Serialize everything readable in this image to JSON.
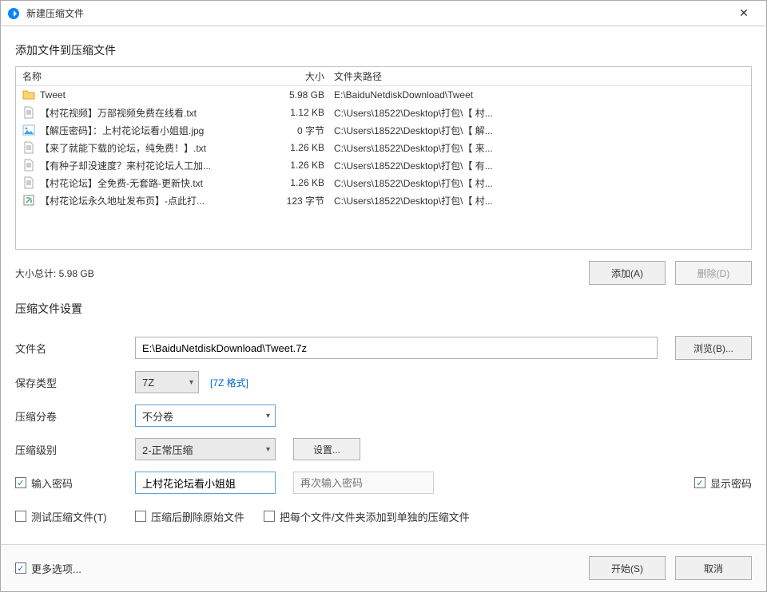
{
  "title": "新建压缩文件",
  "heading_add_files": "添加文件到压缩文件",
  "columns": {
    "name": "名称",
    "size": "大小",
    "path": "文件夹路径"
  },
  "files": [
    {
      "icon": "folder",
      "name": "Tweet",
      "size": "5.98 GB",
      "path": "E:\\BaiduNetdiskDownload\\Tweet"
    },
    {
      "icon": "txt",
      "name": "【村花视频】万部视频免费在线看.txt",
      "size": "1.12 KB",
      "path": "C:\\Users\\18522\\Desktop\\打包\\【 村..."
    },
    {
      "icon": "img",
      "name": "【解压密码】：上村花论坛看小姐姐.jpg",
      "size": "0 字节",
      "path": "C:\\Users\\18522\\Desktop\\打包\\【 解..."
    },
    {
      "icon": "txt",
      "name": "【来了就能下载的论坛，纯免费！】.txt",
      "size": "1.26 KB",
      "path": "C:\\Users\\18522\\Desktop\\打包\\【 来..."
    },
    {
      "icon": "txt",
      "name": "【有种子却没速度？来村花论坛人工加...",
      "size": "1.26 KB",
      "path": "C:\\Users\\18522\\Desktop\\打包\\【 有..."
    },
    {
      "icon": "txt",
      "name": "【村花论坛】全免费-无套路-更新快.txt",
      "size": "1.26 KB",
      "path": "C:\\Users\\18522\\Desktop\\打包\\【 村..."
    },
    {
      "icon": "url",
      "name": "【村花论坛永久地址发布页】-点此打...",
      "size": "123 字节",
      "path": "C:\\Users\\18522\\Desktop\\打包\\【 村..."
    }
  ],
  "total_label": "大小总计: 5.98 GB",
  "buttons": {
    "add": "添加(A)",
    "remove": "删除(D)",
    "browse": "浏览(B)...",
    "settings": "设置...",
    "start": "开始(S)",
    "cancel": "取消",
    "more": "更多选项..."
  },
  "settings_title": "压缩文件设置",
  "labels": {
    "filename": "文件名",
    "savetype": "保存类型",
    "split": "压缩分卷",
    "level": "压缩级别",
    "enterpw": "输入密码",
    "showpw": "显示密码",
    "testarchive": "测试压缩文件(T)",
    "deleteafter": "压缩后删除原始文件",
    "separate": "把每个文件/文件夹添加到单独的压缩文件"
  },
  "values": {
    "filename": "E:\\BaiduNetdiskDownload\\Tweet.7z",
    "savetype": "7Z",
    "format_link": "[7Z 格式]",
    "split": "不分卷",
    "level": "2-正常压缩",
    "password": "上村花论坛看小姐姐",
    "password2_placeholder": "再次输入密码"
  },
  "checked": {
    "enterpw": true,
    "showpw": true,
    "testarchive": false,
    "deleteafter": false,
    "separate": false,
    "more": true
  }
}
